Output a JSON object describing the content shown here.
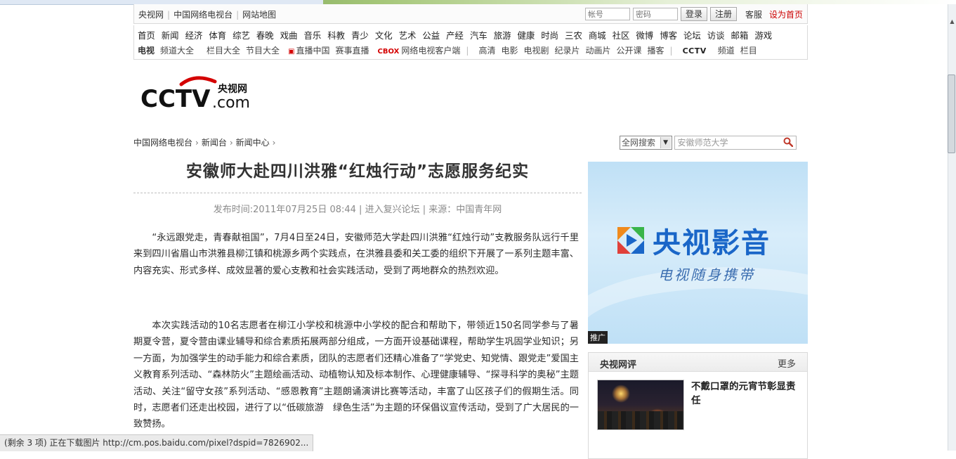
{
  "topbar": {
    "links": [
      "央视网",
      "中国网络电视台",
      "网站地图"
    ],
    "account_placeholder": "帐号",
    "password_placeholder": "密码",
    "login_label": "登录",
    "register_label": "注册",
    "service_label": "客服",
    "homepage_label": "设为首页"
  },
  "nav": {
    "row1": [
      "首页",
      "新闻",
      "经济",
      "体育",
      "综艺",
      "春晚",
      "戏曲",
      "音乐",
      "科教",
      "青少",
      "文化",
      "艺术",
      "公益",
      "产经",
      "汽车",
      "旅游",
      "健康",
      "时尚",
      "三农",
      "商城",
      "社区",
      "微博",
      "博客",
      "论坛",
      "访谈",
      "邮箱",
      "游戏"
    ],
    "row2_tv": "电视",
    "row2_a": [
      "频道大全",
      "栏目大全",
      "节目大全"
    ],
    "row2_live": "直播中国",
    "row2_event": "赛事直播",
    "row2_box_brand": "CBOX",
    "row2_box": "网络电视客户端",
    "row2_b": [
      "高清",
      "电影",
      "电视剧",
      "纪录片",
      "动画片",
      "公开课",
      "播客"
    ],
    "row2_cctv": "CCTV",
    "row2_c": [
      "频道",
      "栏目"
    ]
  },
  "logo": {
    "main": "CCTV",
    "cn": "央视网",
    "com": ".com"
  },
  "breadcrumb": [
    "中国网络电视台",
    "新闻台",
    "新闻中心"
  ],
  "search": {
    "scope": "全网搜索",
    "query": "安徽师范大学"
  },
  "article": {
    "title": "安徽师大赴四川洪雅“红烛行动”志愿服务纪实",
    "meta": "发布时间:2011年07月25日 08:44 | 进入复兴论坛 | 来源：中国青年网",
    "p1": "“永远跟党走，青春献祖国”，7月4日至24日，安徽师范大学赴四川洪雅“红烛行动”支教服务队远行千里来到四川省眉山市洪雅县柳江镇和桃源乡两个实践点，在洪雅县委和关工委的组织下开展了一系列主题丰富、内容充实、形式多样、成效显著的爱心支教和社会实践活动，受到了两地群众的热烈欢迎。",
    "p2": "本次实践活动的10名志愿者在柳江小学校和桃源中小学校的配合和帮助下，带领近150名同学参与了暑期夏令营，夏令营由课业辅导和综合素质拓展两部分组成，一方面开设基础课程，帮助学生巩固学业知识；另一方面，为加强学生的动手能力和综合素质，团队的志愿者们还精心准备了“学党史、知党情、跟党走”爱国主义教育系列活动、“森林防火”主题绘画活动、动植物认知及标本制作、心理健康辅导、“探寻科学的奥秘”主题活动、关注“留守女孩”系列活动、“感恩教育”主题朗诵演讲比赛等活动，丰富了山区孩子们的假期生活。同时，志愿者们还走出校园，进行了以“低碳旅游　绿色生活”为主题的环保倡议宣传活动，受到了广大居民的一致赞扬。"
  },
  "ad": {
    "brand": "央视影音",
    "slogan": "电视随身携带",
    "tag": "推广",
    "colors": {
      "blue": "#1a66c8",
      "orange": "#f08a1c",
      "green": "#3ab54a",
      "red": "#e0403a"
    }
  },
  "review": {
    "title": "央视网评",
    "more": "更多",
    "headline": "不戴口罩的元宵节彰显责任"
  },
  "status": {
    "text": "(剩余 3 项) 正在下载图片 http://cm.pos.baidu.com/pixel?dspid=7826902..."
  },
  "scroll": {
    "up_icon": "▲"
  }
}
